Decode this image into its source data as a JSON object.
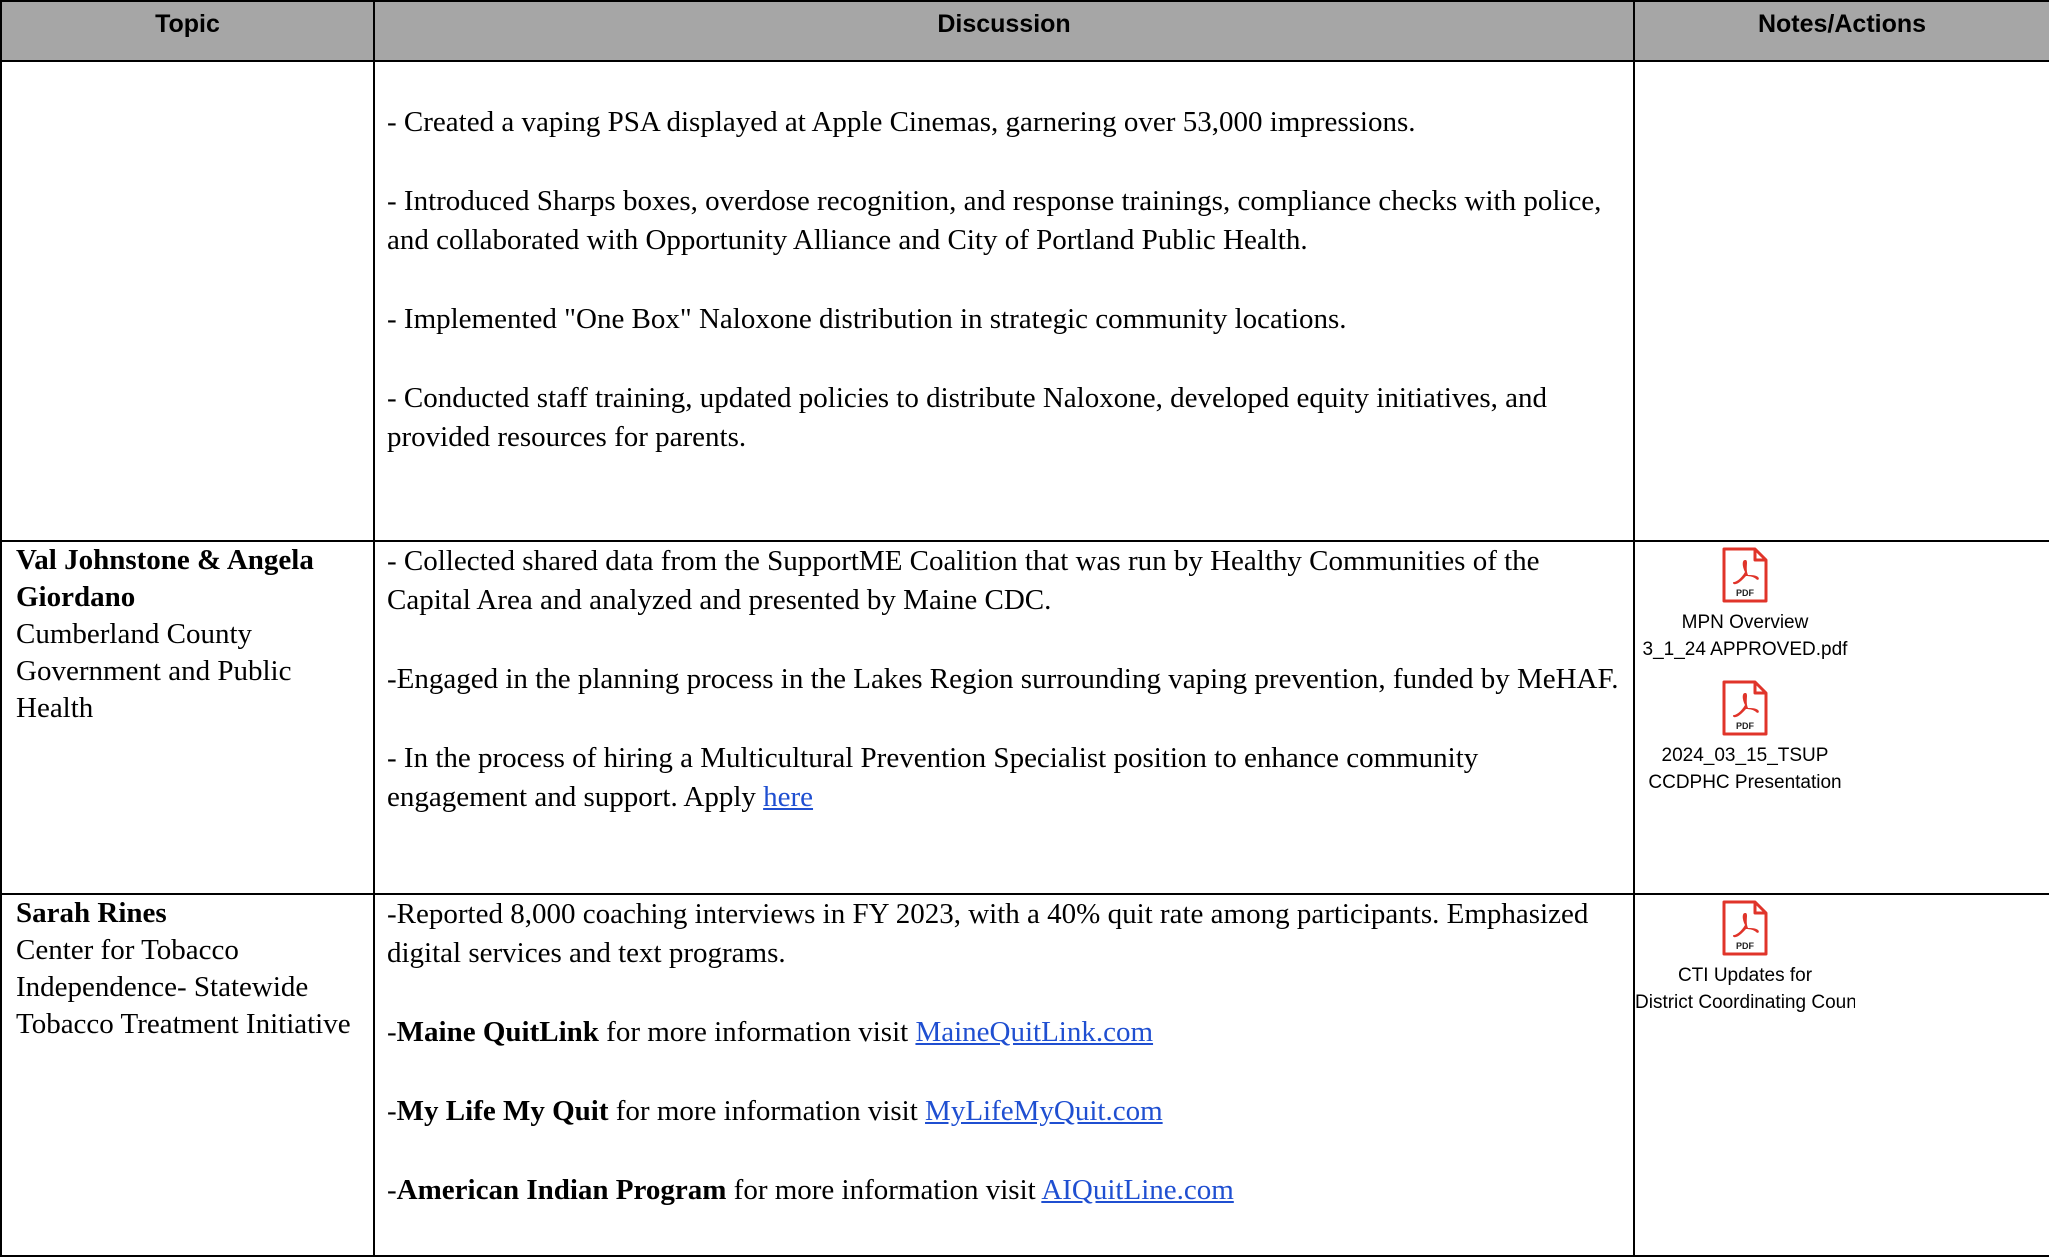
{
  "header": {
    "topic": "Topic",
    "discussion": "Discussion",
    "notes": "Notes/Actions"
  },
  "rows": [
    {
      "topic_name": "",
      "topic_org": "",
      "items": [
        "- Created a vaping PSA displayed at Apple Cinemas, garnering over 53,000 impressions.",
        "- Introduced Sharps boxes, overdose recognition, and response trainings, compliance checks with police, and collaborated with Opportunity Alliance and City of Portland Public Health.",
        "- Implemented \"One Box\" Naloxone distribution in strategic community locations.",
        "- Conducted staff training, updated policies to distribute Naloxone, developed equity initiatives, and provided resources for parents."
      ]
    },
    {
      "topic_name": "Val Johnstone & Angela Giordano",
      "topic_org": "Cumberland County Government and Public Health",
      "items": [
        "- Collected shared data from the SupportME Coalition that was run by Healthy Communities of the Capital Area and analyzed and presented by Maine CDC.",
        "-Engaged in the planning process in the Lakes Region surrounding vaping prevention, funded by MeHAF."
      ],
      "item3_text": "- In the process of hiring a Multicultural Prevention Specialist position to enhance community engagement and support. Apply ",
      "item3_link": "here",
      "attachments": [
        {
          "icon": "pdf-icon",
          "line1": "MPN Overview",
          "line2": "3_1_24 APPROVED.pdf"
        },
        {
          "icon": "pdf-icon",
          "line1": "2024_03_15_TSUP",
          "line2": "CCDPHC Presentation"
        }
      ]
    },
    {
      "topic_name": "Sarah Rines",
      "topic_org": "Center for Tobacco Independence- Statewide Tobacco Treatment Initiative",
      "item1": "-Reported 8,000 coaching interviews in FY 2023, with a 40% quit rate among participants. Emphasized digital services and text programs.",
      "programs": [
        {
          "prefix": "-",
          "name": "Maine QuitLink",
          "text": " for more information visit ",
          "link": "MaineQuitLink.com"
        },
        {
          "prefix": "-",
          "name": "My Life My Quit",
          "text": " for more information visit ",
          "link": "MyLifeMyQuit.com"
        },
        {
          "prefix": "-",
          "name": "American Indian Program",
          "text": " for more information visit ",
          "link": "AIQuitLine.com"
        }
      ],
      "attachments": [
        {
          "icon": "pdf-icon",
          "line1": "CTI Updates for",
          "line2": "District Coordinating Council"
        }
      ]
    }
  ],
  "colors": {
    "header_bg": "#a6a6a6",
    "link": "#1f4fd1",
    "pdf_red": "#e0342a"
  }
}
